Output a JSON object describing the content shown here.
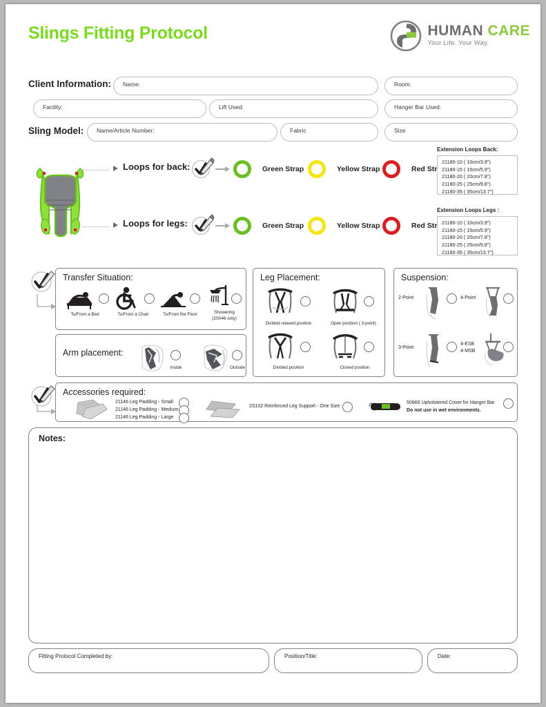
{
  "document": {
    "title": "Slings Fitting Protocol"
  },
  "logo": {
    "word1": "HUMAN",
    "word2": "CARE",
    "tagline": "Your Life. Your Way.",
    "brand_grey": "#6d6e71",
    "brand_green": "#8dc63f"
  },
  "client_information": {
    "label": "Client Information:",
    "fields": [
      {
        "name": "Name:"
      },
      {
        "name": "Room:"
      },
      {
        "name": "Facility:"
      },
      {
        "name": "Lift Used:"
      },
      {
        "name": "Hanger Bar Used:"
      }
    ]
  },
  "sling_model": {
    "label": "Sling Model:",
    "fields": [
      {
        "name": "Name/Article Number:"
      },
      {
        "name": "Fabric"
      },
      {
        "name": "Size"
      }
    ]
  },
  "loops": {
    "back": {
      "label": "Loops for back:",
      "options": [
        {
          "label": "Green Strap",
          "color": "#6abf22"
        },
        {
          "label": "Yellow Strap",
          "color": "#f5e511"
        },
        {
          "label": "Red Straps",
          "color": "#d81f21"
        }
      ]
    },
    "legs": {
      "label": "Loops for legs:",
      "options": [
        {
          "label": "Green Strap",
          "color": "#6abf22"
        },
        {
          "label": "Yellow Strap",
          "color": "#f5e511"
        },
        {
          "label": "Red Straps",
          "color": "#d81f21"
        }
      ]
    }
  },
  "extension_loops_back": {
    "title": "Extension Loops Back:",
    "items": [
      "21180-10 ( 10cm/3.9\")",
      "21180-15 ( 15cm/5.9\")",
      "21180-20 ( 20cm/7.8\")",
      "21180-25 ( 25cm/9.8\")",
      "21180-35 ( 35cm/13.7\")"
    ]
  },
  "extension_loops_legs": {
    "title": "Extension Loops Legs :",
    "items": [
      "21180-10 ( 10cm/3.9\")",
      "21180-15 ( 15cm/5.9\")",
      "21180-20 ( 20cm/7.8\")",
      "21180-25 ( 25cm/9.8\")",
      "21180-35 ( 35cm/13.7\")"
    ]
  },
  "transfer_situation": {
    "title": "Transfer Situation:",
    "options": [
      {
        "label": "To/From a  Bed",
        "icon": "bed-transfer-icon"
      },
      {
        "label": "To/From a Chair",
        "icon": "wheelchair-icon"
      },
      {
        "label": "To/From the Floor",
        "icon": "floor-transfer-icon"
      },
      {
        "label": "Showering",
        "label2": "(2S046 only)",
        "icon": "shower-icon"
      }
    ]
  },
  "arm_placement": {
    "title": "Arm placement:",
    "options": [
      {
        "label": "Inside",
        "icon": "arm-inside-icon"
      },
      {
        "label": "Outside",
        "icon": "arm-outside-icon"
      }
    ]
  },
  "leg_placement": {
    "title": "Leg Placement:",
    "options": [
      {
        "label": "Divided relaxed position",
        "icon": "sling-divided-relaxed-icon"
      },
      {
        "label": "Open position ( 3-point)",
        "icon": "sling-open-3point-icon"
      },
      {
        "label": "Divided position",
        "icon": "sling-divided-icon"
      },
      {
        "label": "Closed position",
        "icon": "sling-closed-icon"
      }
    ]
  },
  "suspension": {
    "title": "Suspension:",
    "options": [
      {
        "label": "2-Point",
        "icon": "suspension-2point-icon"
      },
      {
        "label": "4-Point",
        "icon": "suspension-4point-icon"
      },
      {
        "label": "3-Point",
        "icon": "suspension-3point-icon"
      },
      {
        "label": "4-ESB",
        "label2": "4-MSB",
        "icon": "suspension-4esb-icon"
      }
    ]
  },
  "accessories": {
    "title": "Accessories required:",
    "groups": [
      {
        "icon": "leg-padding-icon",
        "items": [
          "21146  Leg Padding - Small",
          "21146  Leg Padding - Medium",
          "21146  Leg Padding - Large"
        ]
      },
      {
        "icon": "reinforced-leg-support-icon",
        "items": [
          "2S102 Reinforced Leg Support - One Size"
        ]
      },
      {
        "icon": "hanger-bar-cover-icon",
        "items": [
          "50866 Upholstered Cover for Hanger Bar"
        ],
        "warning": "Do not use in wet environments."
      }
    ]
  },
  "notes": {
    "title": "Notes:"
  },
  "footer": {
    "fields": [
      {
        "name": "Fitting Protocol Completed by:"
      },
      {
        "name": "Position/Title:"
      },
      {
        "name": "Date:"
      }
    ]
  }
}
